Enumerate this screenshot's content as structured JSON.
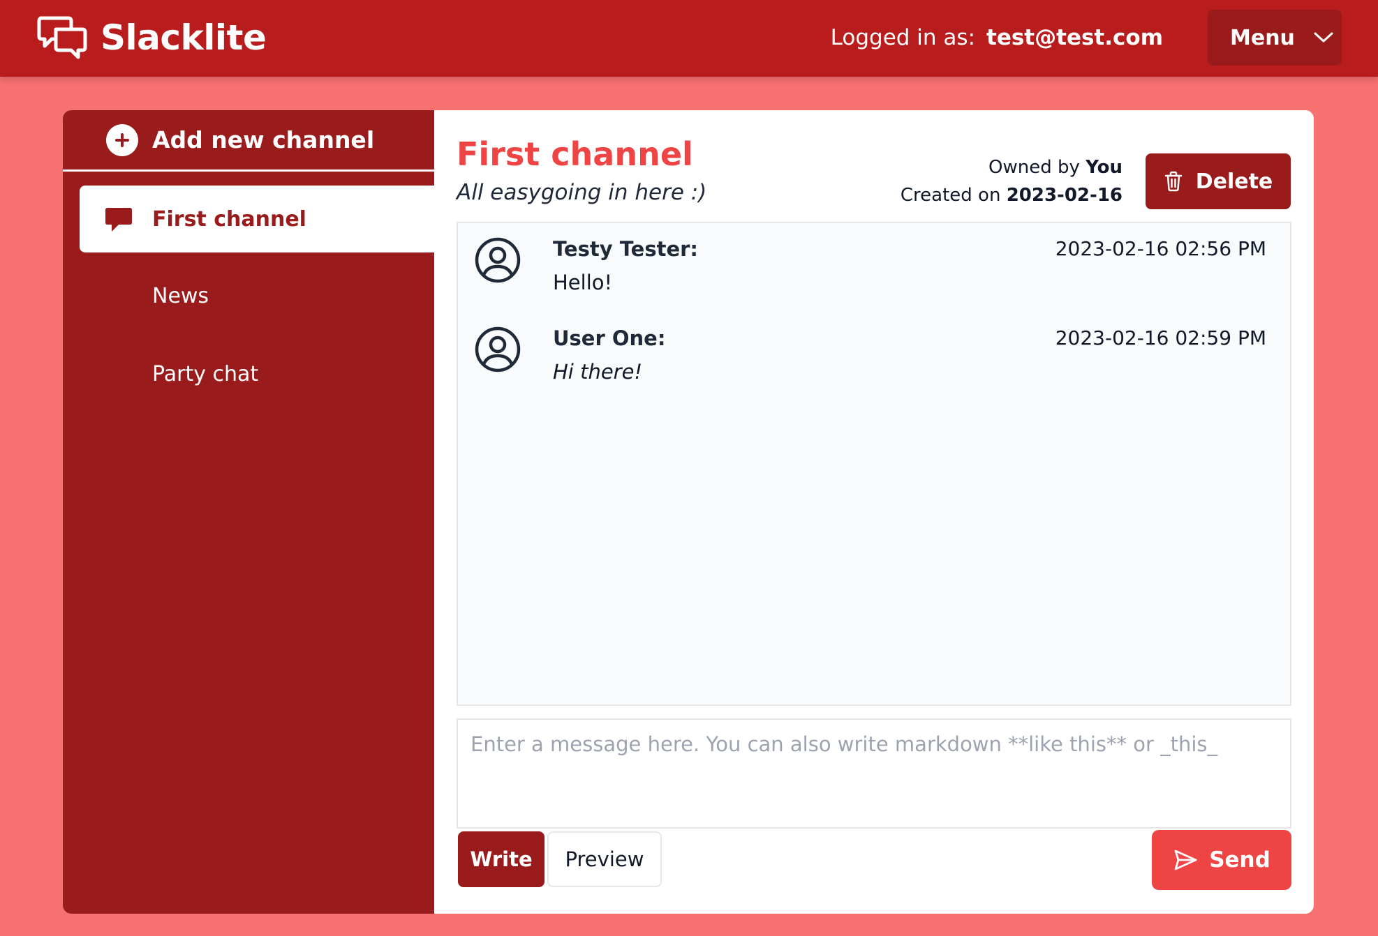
{
  "app": {
    "name": "Slacklite",
    "logged_in_label": "Logged in as:",
    "user_email": "test@test.com",
    "menu_label": "Menu"
  },
  "sidebar": {
    "add_channel_label": "Add new channel",
    "channels": [
      {
        "label": "First channel",
        "active": true
      },
      {
        "label": "News",
        "active": false
      },
      {
        "label": "Party chat",
        "active": false
      }
    ]
  },
  "channel": {
    "title": "First channel",
    "description": "All easygoing in here :)",
    "owned_by_label": "Owned by",
    "owner": "You",
    "created_on_label": "Created on",
    "created_date": "2023-02-16",
    "delete_label": "Delete"
  },
  "messages": [
    {
      "author": "Testy Tester:",
      "timestamp": "2023-02-16 02:56 PM",
      "text": "Hello!",
      "italic": false
    },
    {
      "author": "User One:",
      "timestamp": "2023-02-16 02:59 PM",
      "text": "Hi there!",
      "italic": true
    }
  ],
  "composer": {
    "placeholder": "Enter a message here. You can also write markdown **like this** or _this_",
    "value": "",
    "write_tab": "Write",
    "preview_tab": "Preview",
    "send_label": "Send"
  },
  "colors": {
    "background": "#f87171",
    "header": "#b91c1c",
    "sidebar": "#991b1b",
    "accent": "#ef4444"
  }
}
